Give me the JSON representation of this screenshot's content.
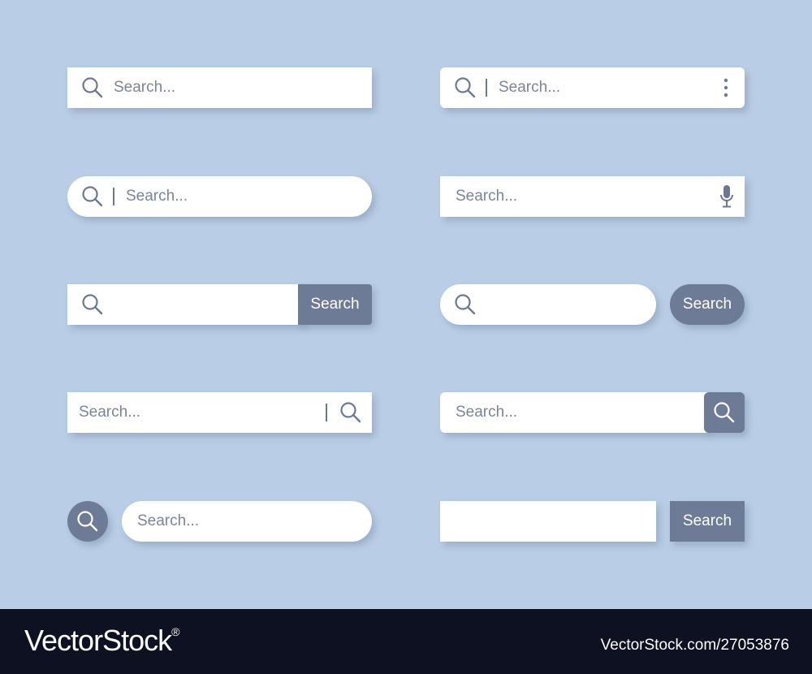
{
  "colors": {
    "background": "#b9cde6",
    "field": "#ffffff",
    "accent_button": "#6d7b96",
    "placeholder": "#7a8698",
    "icon": "#6c7891",
    "footer": "#0e1122"
  },
  "icons": {
    "search": "magnifier-icon",
    "menu": "kebab-menu-icon",
    "voice": "microphone-icon"
  },
  "bars": {
    "b1": {
      "placeholder": "Search..."
    },
    "b2": {
      "placeholder": "Search..."
    },
    "b3": {
      "placeholder": "Search..."
    },
    "b4": {
      "placeholder": "Search..."
    },
    "b5": {
      "placeholder": "",
      "button_label": "Search"
    },
    "b6": {
      "placeholder": "",
      "button_label": "Search"
    },
    "b7": {
      "placeholder": "Search..."
    },
    "b8": {
      "placeholder": "Search..."
    },
    "b9": {
      "placeholder": "Search..."
    },
    "b10": {
      "placeholder": "",
      "button_label": "Search"
    }
  },
  "footer": {
    "brand": "VectorStock",
    "brand_mark": "®",
    "stock_id": "VectorStock.com/27053876"
  }
}
